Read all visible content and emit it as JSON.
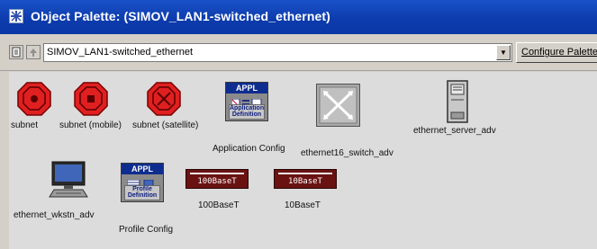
{
  "window": {
    "title": "Object Palette: (SIMOV_LAN1-switched_ethernet)"
  },
  "toolbar": {
    "path_value": "SIMOV_LAN1-switched_ethernet",
    "configure_label": "Configure Palette"
  },
  "palette": {
    "items": [
      {
        "label": "subnet"
      },
      {
        "label": "subnet (mobile)"
      },
      {
        "label": "subnet (satellite)"
      },
      {
        "label": "Application Config",
        "badge": "APPL",
        "sublabel": "Application Definition"
      },
      {
        "label": "ethernet16_switch_adv"
      },
      {
        "label": "ethernet_server_adv"
      },
      {
        "label": "ethernet_wkstn_adv"
      },
      {
        "label": "Profile Config",
        "badge": "APPL",
        "sublabel": "Profile Definition"
      },
      {
        "label": "100BaseT",
        "link_text": "100BaseT"
      },
      {
        "label": "10BaseT",
        "link_text": "10BaseT"
      }
    ]
  },
  "colors": {
    "titlebar": "#0d3cad",
    "subnet_red": "#e02020",
    "appl_header": "#0e2d8f",
    "link_body": "#6a1212"
  }
}
